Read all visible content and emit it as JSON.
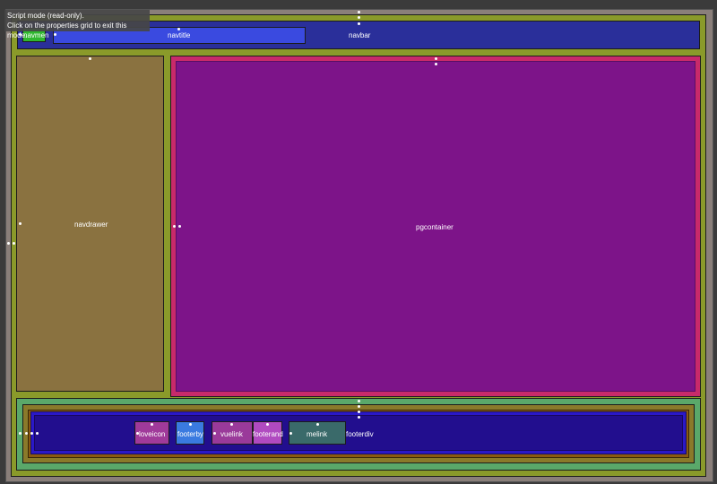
{
  "tooltip": {
    "line1": "Script mode (read-only).",
    "line2": "Click on the properties grid to exit this mode."
  },
  "regions": {
    "navbar": "navbar",
    "navmenu": "navmen",
    "navtitle": "navtitle",
    "navdrawer": "navdrawer",
    "pgcontainer": "pgcontainer",
    "footerdiv": "footerdiv",
    "loveicon": "loveicon",
    "footerby": "footerby",
    "vuelink": "vuelink",
    "footerand": "footerand",
    "melink": "melink"
  },
  "colors": {
    "page_bg": "#3b3b3b",
    "outer_frame": "#8a7f7a",
    "app_bg": "#8a9a2a",
    "navbar": "#2a2f9a",
    "navmenu": "#2fb82f",
    "navtitle": "#3a4ae0",
    "navdrawer": "#8a7240",
    "pgcontainer_outer": "#c82a6a",
    "pgcontainer": "#7d1489",
    "footer_outer": "#5aa86a",
    "footer_mid": "#8a5a10",
    "footer_inner_border": "#2a18c8",
    "footerdiv": "#220e8e",
    "loveicon": "#a03a9a",
    "footerby": "#3a7ae0",
    "vuelink": "#9a3a9a",
    "footerand": "#b04ac0",
    "melink": "#3a6a6a"
  }
}
